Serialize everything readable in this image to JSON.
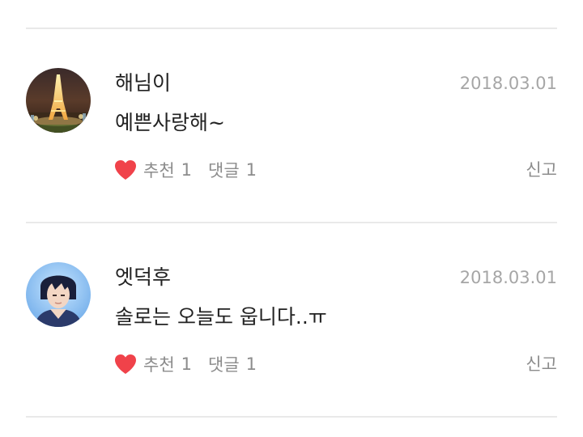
{
  "comments": [
    {
      "username": "해님이",
      "date": "2018.03.01",
      "text": "예쁜사랑해~",
      "like_label": "추천",
      "like_count": "1",
      "reply_label": "댓글",
      "reply_count": "1",
      "report_label": "신고",
      "avatar_icon": "eiffel-tower-photo-avatar"
    },
    {
      "username": "엣덕후",
      "date": "2018.03.01",
      "text": "솔로는 오늘도 웁니다..ㅠ",
      "like_label": "추천",
      "like_count": "1",
      "reply_label": "댓글",
      "reply_count": "1",
      "report_label": "신고",
      "avatar_icon": "person-photo-avatar"
    }
  ],
  "colors": {
    "heart": "#f0424a",
    "date": "#a6a6a6",
    "action_text": "#8c8c8c",
    "divider": "#e9e9e9"
  },
  "icons": {
    "like": "heart-icon"
  }
}
